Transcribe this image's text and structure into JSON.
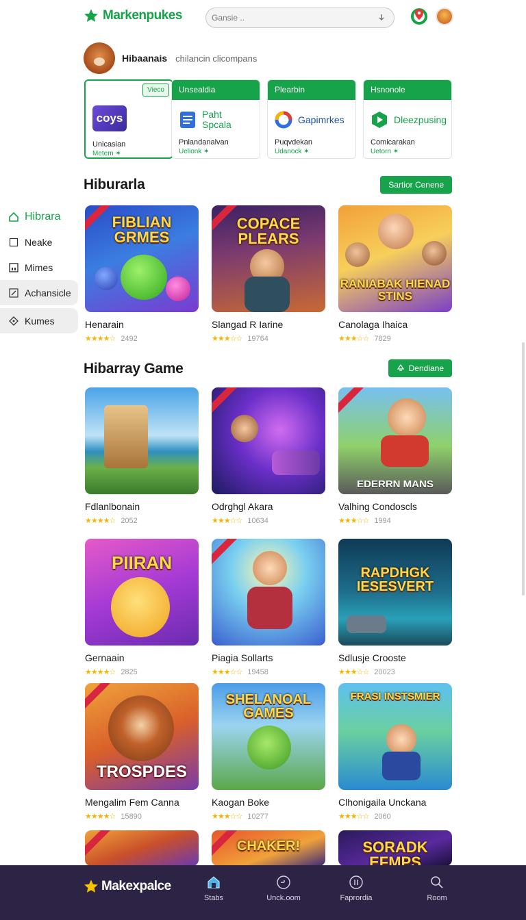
{
  "header": {
    "brand": "Markenpukes",
    "search_placeholder": "Gansie .."
  },
  "account": {
    "name": "Hibaanais",
    "subtitle": "chilancin clicompans"
  },
  "promos": [
    {
      "head": "",
      "badge": "Vieco",
      "title": "coys",
      "line1": "Unicasian",
      "line2": "Metem ✶",
      "icon": "app-icon-purple"
    },
    {
      "head": "Unsealdia",
      "title": "Paht Spcala",
      "line1": "Pnlandanalvan",
      "line2": "Uelionk ✶",
      "icon": "docs-icon"
    },
    {
      "head": "Plearbin",
      "title": "Gapimrkes",
      "line1": "Puqvdekan",
      "line2": "Udanock ✶",
      "icon": "color-ring-icon"
    },
    {
      "head": "Hsnonole",
      "title": "Dleezpusing",
      "line1": "Comicarakan",
      "line2": "Uetorn ✶",
      "icon": "play-icon"
    }
  ],
  "sidebar": {
    "items": [
      {
        "label": "Hibrara",
        "icon": "home-icon"
      },
      {
        "label": "Neake",
        "icon": "square-icon"
      },
      {
        "label": "Mimes",
        "icon": "image-icon"
      },
      {
        "label": "Achansicle",
        "icon": "edit-icon"
      },
      {
        "label": "Kumes",
        "icon": "diamond-icon"
      }
    ]
  },
  "section1": {
    "title": "Hiburarla",
    "button": "Sartior Cenene"
  },
  "section2": {
    "title": "Hibarray Game",
    "button": "Dendiane"
  },
  "games_row1": [
    {
      "name": "Henarain",
      "rating": 3.5,
      "count": "2492",
      "art_title": "FIBLIAN GRMES"
    },
    {
      "name": "Slangad R Iarine",
      "rating": 3,
      "count": "19764",
      "art_title": "COPACE PLEARS"
    },
    {
      "name": "Canolaga Ihaica",
      "rating": 3,
      "count": "7829",
      "art_title": "RANIABAK HIENAD STINS"
    }
  ],
  "games_grid": [
    {
      "name": "Fdlanlbonain",
      "rating": 3.5,
      "count": "2052",
      "art_title": ""
    },
    {
      "name": "Odrghgl Akara",
      "rating": 3,
      "count": "10634",
      "art_title": ""
    },
    {
      "name": "Valhing Condoscls",
      "rating": 3,
      "count": "1994",
      "art_title": "EDERRN MANS"
    },
    {
      "name": "Gernaain",
      "rating": 3.5,
      "count": "2825",
      "art_title": "PIIRAN"
    },
    {
      "name": "Piagia Sollarts",
      "rating": 3,
      "count": "19458",
      "art_title": ""
    },
    {
      "name": "Sdlusje Crooste",
      "rating": 3,
      "count": "20023",
      "art_title": "RAPDHGK IESESVERT"
    },
    {
      "name": "Mengalim Fem Canna",
      "rating": 3.5,
      "count": "15890",
      "art_title": "TROSPDES"
    },
    {
      "name": "Kaogan Boke",
      "rating": 3,
      "count": "10277",
      "art_title": "SHELANOAL GAMES"
    },
    {
      "name": "Clhonigaila Unckana",
      "rating": 3,
      "count": "2060",
      "art_title": "FRASI INSTSMIER"
    },
    {
      "name": "",
      "rating": 0,
      "count": "",
      "art_title": ""
    },
    {
      "name": "",
      "rating": 0,
      "count": "",
      "art_title": "CHAKER!"
    },
    {
      "name": "",
      "rating": 0,
      "count": "",
      "art_title": "SORADK EFMPS"
    }
  ],
  "bottom_nav": {
    "brand": "Makexpalce",
    "items": [
      {
        "label": "Stabs",
        "icon": "home-icon"
      },
      {
        "label": "Unck.oom",
        "icon": "clock-icon"
      },
      {
        "label": "Faprordia",
        "icon": "compass-icon"
      },
      {
        "label": "Room",
        "icon": "search-icon"
      }
    ]
  },
  "colors": {
    "brand_green": "#16a34a",
    "bottom_bar": "#2d2445",
    "star": "#f5b400"
  }
}
